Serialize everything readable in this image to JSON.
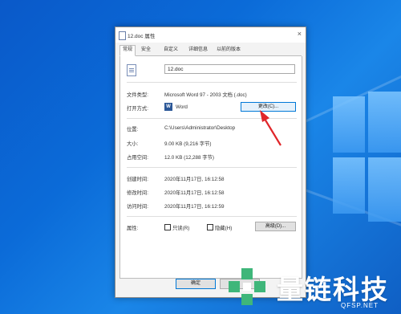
{
  "window": {
    "title": "12.doc 属性",
    "close_glyph": "×"
  },
  "tabs": [
    {
      "label": "常规",
      "active": true
    },
    {
      "label": "安全",
      "active": false
    },
    {
      "label": "自定义",
      "active": false
    },
    {
      "label": "详细信息",
      "active": false
    },
    {
      "label": "以前的版本",
      "active": false
    }
  ],
  "general": {
    "file_name": "12.doc",
    "file_type_label": "文件类型:",
    "file_type_value": "Microsoft Word 97 - 2003 文档 (.doc)",
    "open_with_label": "打开方式:",
    "open_with_value": "Word",
    "change_button": "更改(C)...",
    "location_label": "位置:",
    "location_value": "C:\\Users\\Administrator\\Desktop",
    "size_label": "大小:",
    "size_value": "9.00 KB (9,216 字节)",
    "disk_size_label": "占用空间:",
    "disk_size_value": "12.0 KB (12,288 字节)",
    "created_label": "创建时间:",
    "created_value": "2020年11月17日, 16:12:58",
    "modified_label": "修改时间:",
    "modified_value": "2020年11月17日, 16:12:58",
    "accessed_label": "访问时间:",
    "accessed_value": "2020年11月17日, 16:12:59",
    "attributes_label": "属性:",
    "readonly_label": "只读(R)",
    "hidden_label": "隐藏(H)",
    "advanced_button": "高级(D)..."
  },
  "footer": {
    "ok_button": "确定"
  },
  "watermark": {
    "brand_name": "量链科技",
    "url": "QFSP.NET"
  },
  "colors": {
    "desktop_blue": "#0b6bd8",
    "arrow_red": "#e0262a",
    "brand_green": "#3fb67a"
  }
}
